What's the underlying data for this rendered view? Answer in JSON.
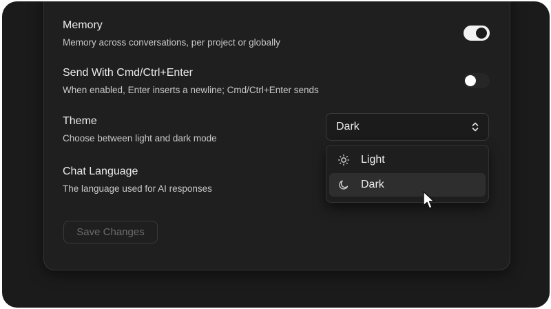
{
  "settings": {
    "memory": {
      "title": "Memory",
      "description": "Memory across conversations, per project or globally",
      "enabled": true
    },
    "send_with_enter": {
      "title": "Send With Cmd/Ctrl+Enter",
      "description": "When enabled, Enter inserts a newline; Cmd/Ctrl+Enter sends",
      "enabled": false
    },
    "theme": {
      "title": "Theme",
      "description": "Choose between light and dark mode",
      "selected": "Dark",
      "options": [
        {
          "label": "Light",
          "icon": "sun-icon"
        },
        {
          "label": "Dark",
          "icon": "moon-icon"
        }
      ]
    },
    "chat_language": {
      "title": "Chat Language",
      "description": "The language used for AI responses"
    }
  },
  "actions": {
    "save_label": "Save Changes"
  },
  "colors": {
    "background": "#1b1b1b",
    "card": "#1f1f1f",
    "text": "#ececec",
    "muted": "#6d6d6d"
  }
}
